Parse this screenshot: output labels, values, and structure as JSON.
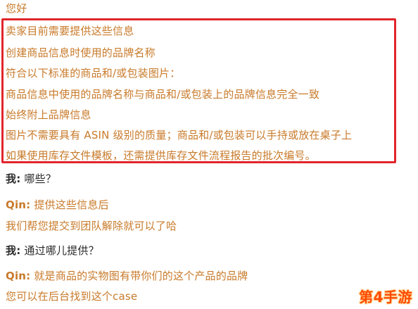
{
  "chat": {
    "greeting": "您好",
    "box_lines": [
      "卖家目前需要提供这些信息",
      "创建商品信息时使用的品牌名称",
      "符合以下标准的商品和/或包装图片：",
      "商品信息中使用的品牌名称与商品和/或包装上的品牌信息完全一致",
      "始终附上品牌信息",
      "图片不需要具有 ASIN 级别的质量；商品和/或包装可以手持或放在桌子上",
      "如果使用库存文件模板，还需提供库存文件流程报告的批次编号。"
    ],
    "me_label": "我:",
    "me_q1": "哪些？",
    "qin_label": "Qin:",
    "qin_a1": "提供这些信息后",
    "qin_a1_cont": "我们帮您提交到团队解除就可以了哈",
    "me_q2": "通过哪儿提供？",
    "qin_a2": "就是商品的实物图有带你们的这个产品的品牌",
    "qin_a2_cont": "您可以在后台找到这个case"
  },
  "watermark": {
    "text": "第4手游"
  },
  "colors": {
    "orange_text": "#c87a2a",
    "dark_text": "#2a2a2a",
    "highlight_border": "#e1252b",
    "watermark": "#ff4a00"
  }
}
